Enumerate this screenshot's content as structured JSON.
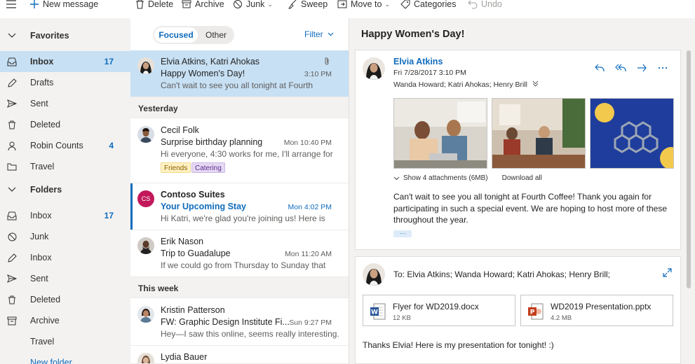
{
  "toolbar": {
    "new_message": "New message",
    "delete": "Delete",
    "archive": "Archive",
    "junk": "Junk",
    "sweep": "Sweep",
    "move_to": "Move to",
    "categories": "Categories",
    "undo": "Undo"
  },
  "nav": {
    "favorites": "Favorites",
    "fav_items": [
      {
        "label": "Inbox",
        "count": "17",
        "icon": "inbox-icon"
      },
      {
        "label": "Drafts",
        "count": "",
        "icon": "pencil-icon"
      },
      {
        "label": "Sent",
        "count": "",
        "icon": "send-icon"
      },
      {
        "label": "Deleted",
        "count": "",
        "icon": "trash-icon"
      },
      {
        "label": "Robin Counts",
        "count": "4",
        "icon": "person-icon"
      },
      {
        "label": "Travel",
        "count": "",
        "icon": "folder-icon"
      }
    ],
    "folders": "Folders",
    "folder_items": [
      {
        "label": "Inbox",
        "count": "17",
        "icon": "inbox-icon"
      },
      {
        "label": "Junk",
        "count": "",
        "icon": "block-icon"
      },
      {
        "label": "Inbox",
        "count": "",
        "icon": "pencil-icon"
      },
      {
        "label": "Sent",
        "count": "",
        "icon": "send-icon"
      },
      {
        "label": "Deleted",
        "count": "",
        "icon": "trash-icon"
      },
      {
        "label": "Archive",
        "count": "",
        "icon": "archive-icon"
      },
      {
        "label": "Travel",
        "count": "",
        "icon": ""
      }
    ],
    "new_folder": "New folder"
  },
  "list": {
    "tab_focused": "Focused",
    "tab_other": "Other",
    "filter": "Filter",
    "group_yesterday": "Yesterday",
    "group_this_week": "This week",
    "messages": [
      {
        "from": "Elvia Atkins, Katri Ahokas",
        "subject": "Happy Women's Day!",
        "time": "3:10 PM",
        "preview": "Can't wait to see you all tonight at Fourth"
      },
      {
        "from": "Cecil Folk",
        "subject": "Surprise birthday planning",
        "time": "Mon 10:40 PM",
        "preview": "Hi everyone, 4:30 works for me, I'll arrange for",
        "categories": [
          "Friends",
          "Catering"
        ]
      },
      {
        "from": "Contoso Suites",
        "subject": "Your Upcoming Stay",
        "time": "Mon 4:02 PM",
        "preview": "Hi Katri, we're glad you're joining us! Here is",
        "initials": "CS"
      },
      {
        "from": "Erik Nason",
        "subject": "Trip to Guadalupe",
        "time": "Mon 11:20 AM",
        "preview": "If we could go from Thursday to Sunday that"
      },
      {
        "from": "Kristin Patterson",
        "subject": "FW: Graphic Design Institute Fi...",
        "time": "Sun 9:27 PM",
        "preview": "Hey—I saw this online, seems really interesting."
      },
      {
        "from": "Lydia Bauer",
        "subject": "",
        "time": "",
        "preview": ""
      }
    ]
  },
  "reading": {
    "title": "Happy Women's Day!",
    "from": "Elvia Atkins",
    "date": "Fri 7/28/2017 3:10 PM",
    "to": "Wanda Howard; Katri Ahokas; Henry Brill",
    "show_attachments": "Show 4 attachments (6MB)",
    "download_all": "Download all",
    "body": "Can't wait to see you all tonight at Fourth Coffee! Thank you again for participating in such a special event. We are hoping to host more of these throughout the year.",
    "more": "···",
    "reply_to": "To: Elvia Atkins; Wanda Howard; Katri Ahokas; Henry Brill;",
    "files": [
      {
        "name": "Flyer for WD2019.docx",
        "size": "12 KB",
        "type": "word"
      },
      {
        "name": "WD2019 Presentation.pptx",
        "size": "4.2 MB",
        "type": "powerpoint"
      }
    ],
    "reply_body": "Thanks Elvia! Here is my presentation for tonight! :)"
  },
  "colors": {
    "accent": "#0f6cbd",
    "selected": "#c7e0f4",
    "word": "#2b579a",
    "powerpoint": "#c43e1c"
  }
}
